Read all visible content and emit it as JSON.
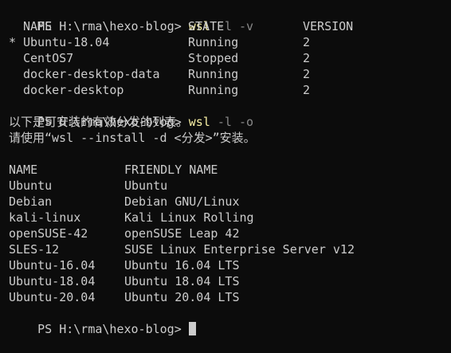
{
  "prompt": "PS H:\\rma\\hexo-blog> ",
  "cmd1": {
    "exe": "wsl",
    "args": " -l -v"
  },
  "list_headers": {
    "name": "NAME",
    "state": "STATE",
    "version": "VERSION"
  },
  "distros": [
    {
      "marker": "*",
      "name": "Ubuntu-18.04",
      "state": "Running",
      "version": "2"
    },
    {
      "marker": "",
      "name": "CentOS7",
      "state": "Stopped",
      "version": "2"
    },
    {
      "marker": "",
      "name": "docker-desktop-data",
      "state": "Running",
      "version": "2"
    },
    {
      "marker": "",
      "name": "docker-desktop",
      "state": "Running",
      "version": "2"
    }
  ],
  "cmd2": {
    "exe": "wsl",
    "args": " -l -o"
  },
  "online_msg1": "以下是可安装的有效分发的列表。",
  "online_msg2": "请使用“wsl --install -d <分发>”安装。",
  "online_headers": {
    "name": "NAME",
    "friendly": "FRIENDLY NAME"
  },
  "online": [
    {
      "name": "Ubuntu",
      "friendly": "Ubuntu"
    },
    {
      "name": "Debian",
      "friendly": "Debian GNU/Linux"
    },
    {
      "name": "kali-linux",
      "friendly": "Kali Linux Rolling"
    },
    {
      "name": "openSUSE-42",
      "friendly": "openSUSE Leap 42"
    },
    {
      "name": "SLES-12",
      "friendly": "SUSE Linux Enterprise Server v12"
    },
    {
      "name": "Ubuntu-16.04",
      "friendly": "Ubuntu 16.04 LTS"
    },
    {
      "name": "Ubuntu-18.04",
      "friendly": "Ubuntu 18.04 LTS"
    },
    {
      "name": "Ubuntu-20.04",
      "friendly": "Ubuntu 20.04 LTS"
    }
  ],
  "colors": {
    "background": "#0c0c0c",
    "text": "#cccccc",
    "command": "#f9f1a5",
    "flag": "#8a8a8a"
  }
}
